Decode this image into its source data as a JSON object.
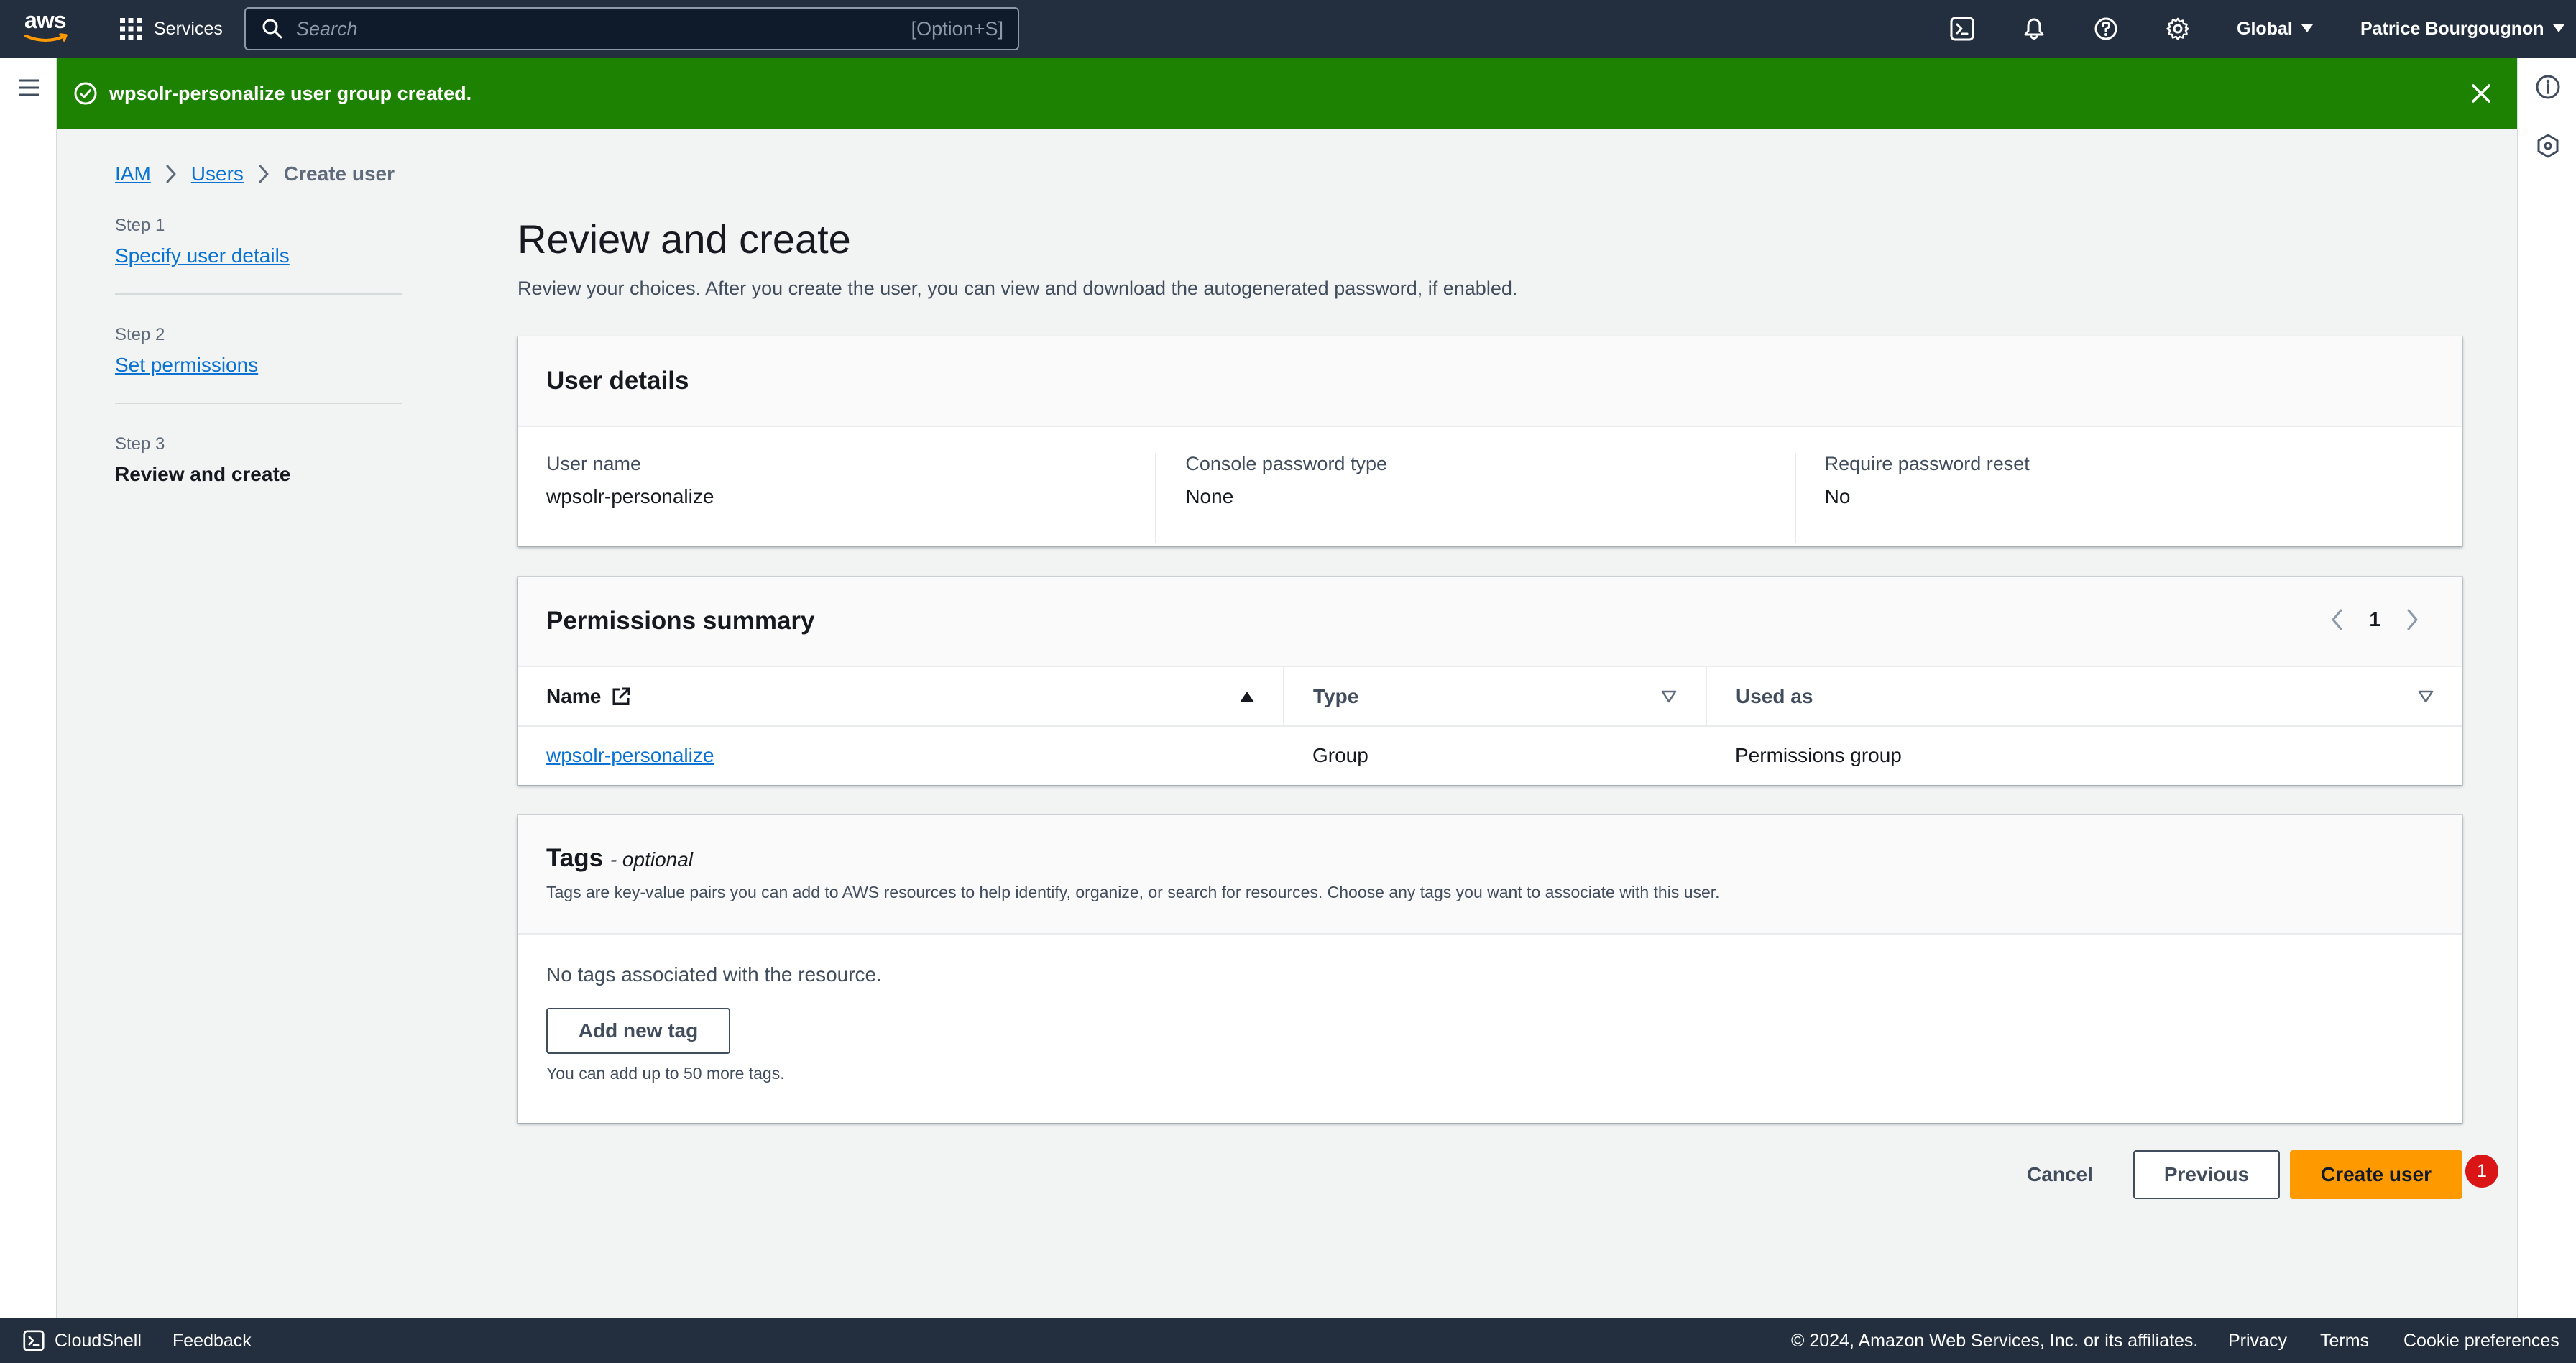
{
  "topnav": {
    "logo_text": "aws",
    "services_label": "Services",
    "search": {
      "placeholder": "Search",
      "shortcut": "[Option+S]"
    },
    "region": "Global",
    "user": "Patrice Bourgougnon",
    "icons": [
      "cloudshell-icon",
      "bell-icon",
      "help-icon",
      "gear-icon"
    ]
  },
  "flash": {
    "message": "wpsolr-personalize user group created.",
    "status_color": "#1d8102"
  },
  "breadcrumbs": [
    {
      "label": "IAM"
    },
    {
      "label": "Users"
    },
    {
      "label": "Create user"
    }
  ],
  "steps": [
    {
      "num": "Step 1",
      "name": "Specify user details"
    },
    {
      "num": "Step 2",
      "name": "Set permissions"
    },
    {
      "num": "Step 3",
      "name": "Review and create"
    }
  ],
  "main": {
    "title": "Review and create",
    "description": "Review your choices. After you create the user, you can view and download the autogenerated password, if enabled."
  },
  "user_details": {
    "heading": "User details",
    "fields": [
      {
        "key": "User name",
        "value": "wpsolr-personalize"
      },
      {
        "key": "Console password type",
        "value": "None"
      },
      {
        "key": "Require password reset",
        "value": "No"
      }
    ]
  },
  "permissions": {
    "heading": "Permissions summary",
    "page": "1",
    "columns": [
      "Name",
      "Type",
      "Used as"
    ],
    "rows": [
      {
        "name": "wpsolr-personalize",
        "type": "Group",
        "used_as": "Permissions group"
      }
    ]
  },
  "tags": {
    "heading": "Tags",
    "optional": "- optional",
    "description": "Tags are key-value pairs you can add to AWS resources to help identify, organize, or search for resources. Choose any tags you want to associate with this user.",
    "empty": "No tags associated with the resource.",
    "add_label": "Add new tag",
    "note": "You can add up to 50 more tags."
  },
  "actions": {
    "cancel": "Cancel",
    "previous": "Previous",
    "create": "Create user",
    "badge": "1",
    "accent_color": "#ff9900"
  },
  "footer": {
    "cloudshell": "CloudShell",
    "feedback": "Feedback",
    "copyright": "© 2024, Amazon Web Services, Inc. or its affiliates.",
    "privacy": "Privacy",
    "terms": "Terms",
    "cookies": "Cookie preferences"
  }
}
